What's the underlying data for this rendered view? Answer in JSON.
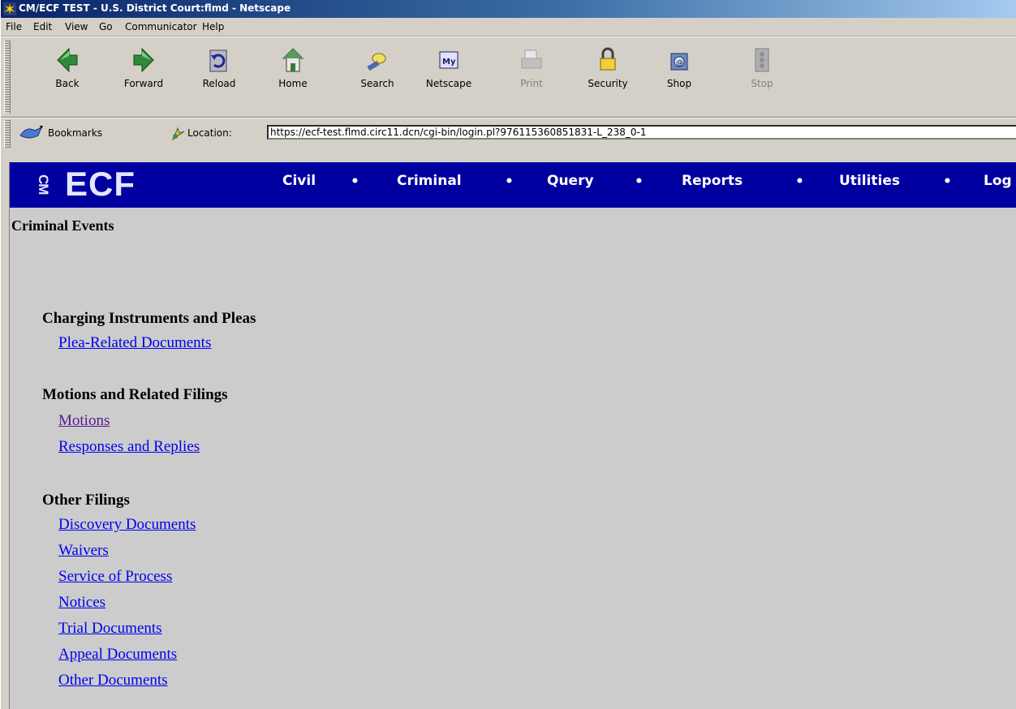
{
  "window": {
    "title": "CM/ECF TEST - U.S. District Court:flmd - Netscape"
  },
  "menu": {
    "items": [
      "File",
      "Edit",
      "View",
      "Go",
      "Communicator",
      "Help"
    ]
  },
  "toolbar": {
    "buttons": [
      {
        "label": "Back",
        "icon": "back-arrow-icon",
        "enabled": true
      },
      {
        "label": "Forward",
        "icon": "forward-arrow-icon",
        "enabled": true
      },
      {
        "label": "Reload",
        "icon": "reload-icon",
        "enabled": true
      },
      {
        "label": "Home",
        "icon": "home-icon",
        "enabled": true
      },
      {
        "label": "Search",
        "icon": "search-icon",
        "enabled": true
      },
      {
        "label": "Netscape",
        "icon": "netscape-icon",
        "enabled": true
      },
      {
        "label": "Print",
        "icon": "print-icon",
        "enabled": false
      },
      {
        "label": "Security",
        "icon": "security-lock-icon",
        "enabled": true
      },
      {
        "label": "Shop",
        "icon": "shop-icon",
        "enabled": true
      },
      {
        "label": "Stop",
        "icon": "stop-icon",
        "enabled": false
      }
    ]
  },
  "location": {
    "bookmarks_label": "Bookmarks",
    "location_label": "Location:",
    "url": "https://ecf-test.flmd.circ11.dcn/cgi-bin/login.pl?976115360851831-L_238_0-1"
  },
  "banner": {
    "logo_text": "ECF",
    "logo_prefix": "CM",
    "nav": [
      "Civil",
      "Criminal",
      "Query",
      "Reports",
      "Utilities",
      "Log"
    ]
  },
  "page": {
    "title": "Criminal Events",
    "sections": [
      {
        "heading": "Charging Instruments and Pleas",
        "links": [
          {
            "label": "Plea-Related Documents",
            "visited": false
          }
        ]
      },
      {
        "heading": "Motions and Related Filings",
        "links": [
          {
            "label": "Motions",
            "visited": true
          },
          {
            "label": "Responses and Replies",
            "visited": false
          }
        ]
      },
      {
        "heading": "Other Filings",
        "links": [
          {
            "label": "Discovery Documents",
            "visited": false
          },
          {
            "label": "Waivers",
            "visited": false
          },
          {
            "label": "Service of Process",
            "visited": false
          },
          {
            "label": "Notices",
            "visited": false
          },
          {
            "label": "Trial Documents",
            "visited": false
          },
          {
            "label": "Appeal Documents",
            "visited": false
          },
          {
            "label": "Other Documents",
            "visited": false
          }
        ]
      }
    ]
  },
  "colors": {
    "banner_bg": "#0000a0",
    "link": "#0000ee",
    "visited_link": "#551a8b",
    "content_bg": "#cccccc"
  }
}
